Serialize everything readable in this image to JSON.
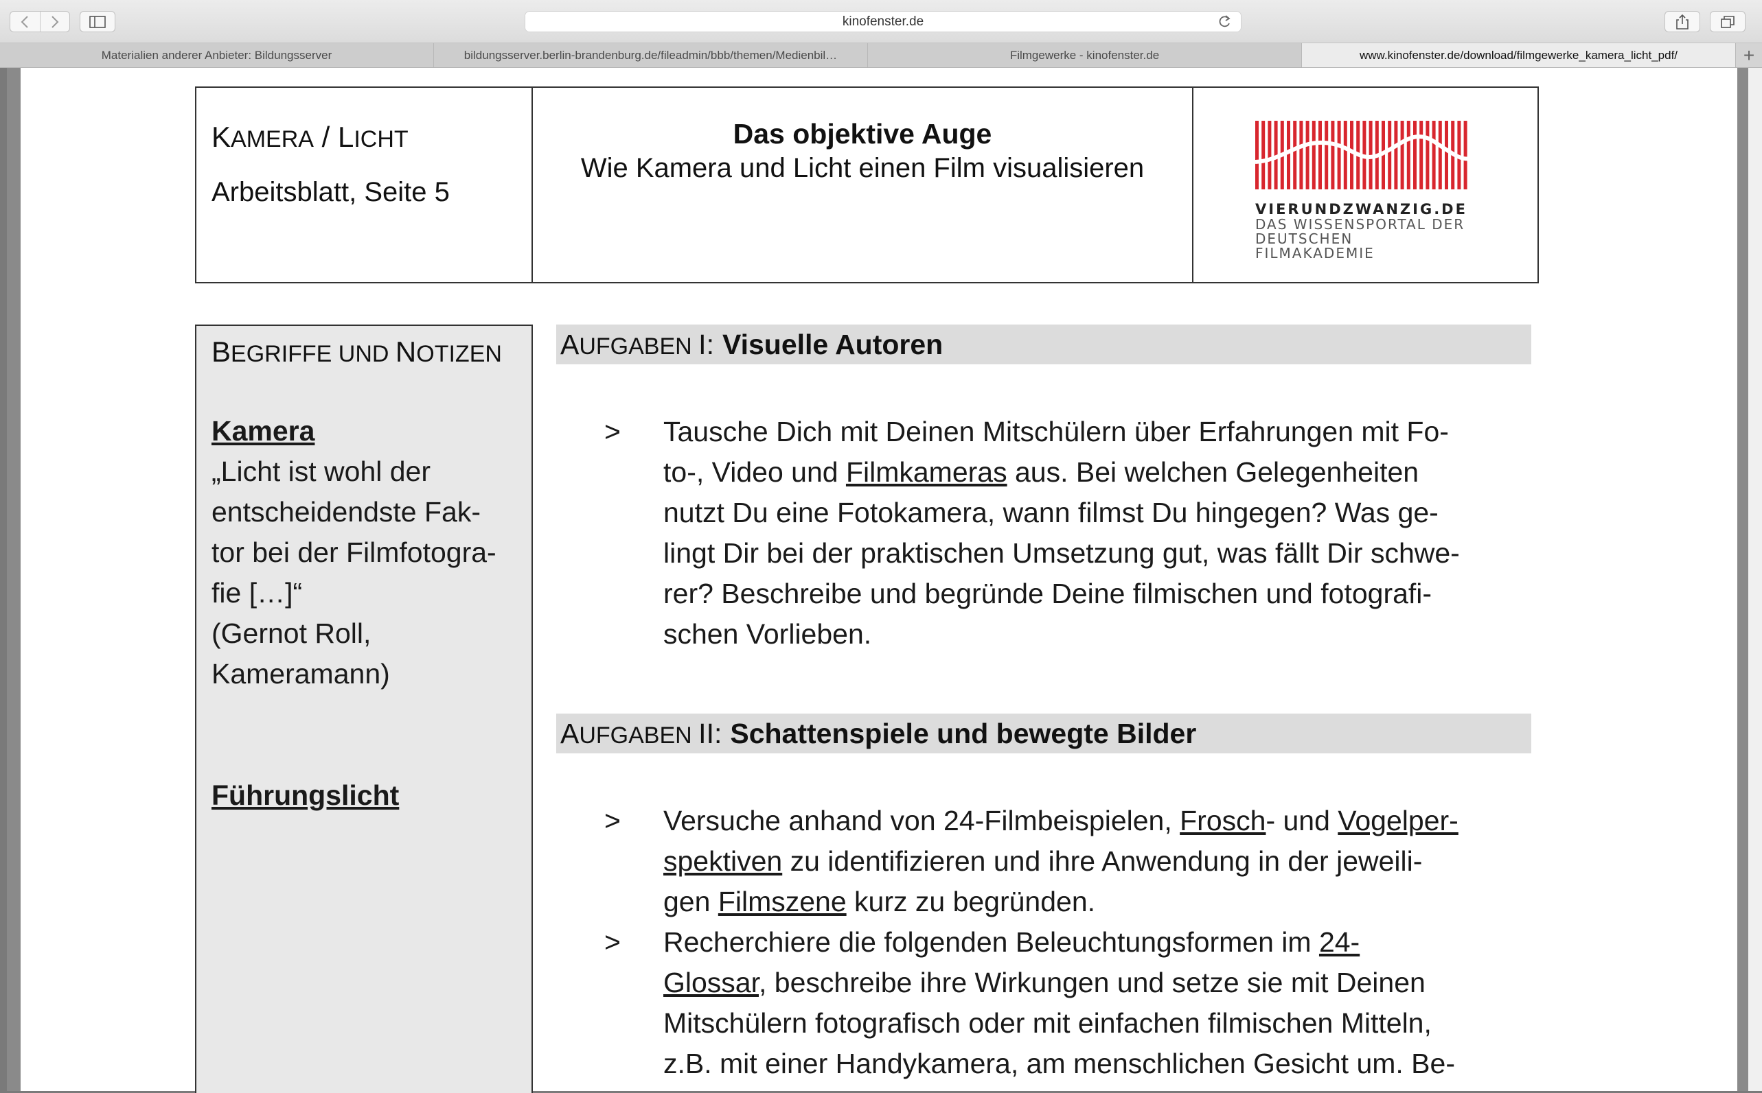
{
  "browser": {
    "address": "kinofenster.de",
    "tabs": [
      {
        "label": "Materialien anderer Anbieter: Bildungsserver",
        "active": false
      },
      {
        "label": "bildungsserver.berlin-brandenburg.de/fileadmin/bbb/themen/Medienbil…",
        "active": false
      },
      {
        "label": "Filmgewerke - kinofenster.de",
        "active": false
      },
      {
        "label": "www.kinofenster.de/download/filmgewerke_kamera_licht_pdf/",
        "active": true
      }
    ],
    "new_tab_symbol": "+"
  },
  "header": {
    "section_first_big": "K",
    "section_first_small": "AMERA",
    "section_sep": " / ",
    "section_second_big": "L",
    "section_second_small": "ICHT",
    "sheet_page": "Arbeitsblatt, Seite 5",
    "title": "Das objektive Auge",
    "subtitle": "Wie Kamera und Licht einen Film visualisieren",
    "logo_line1": "VIERUNDZWANZIG.DE",
    "logo_line2": "DAS WISSENSPORTAL DER",
    "logo_line3": "DEUTSCHEN FILMAKADEMIE",
    "logo_color": "#d8262e"
  },
  "notes": {
    "heading_b1": "B",
    "heading_s1": "EGRIFFE UND ",
    "heading_b2": "N",
    "heading_s2": "OTIZEN",
    "term1": "Kamera",
    "quote_lines": [
      "„Licht ist wohl der",
      "entscheidendste Fak-",
      "tor bei der Filmfotogra-",
      "fie […]“",
      "(Gernot Roll,",
      "Kameramann)"
    ],
    "term2": "Führungslicht"
  },
  "tasks": {
    "one": {
      "prefix_big": "A",
      "prefix_small": "UFGABEN ",
      "numeral": "I:",
      "title": "Visuelle Autoren"
    },
    "two": {
      "prefix_big": "A",
      "prefix_small": "UFGABEN ",
      "numeral": "II:",
      "title": "Schattenspiele und bewegte Bilder"
    },
    "arrow": ">",
    "b1": {
      "l1": "Tausche Dich mit Deinen Mitschülern über Erfahrungen mit Fo-",
      "l2a": "to-, Video und ",
      "l2link": "Filmkameras",
      "l2b": " aus. Bei welchen Gelegenheiten",
      "l3": "nutzt Du eine Fotokamera, wann filmst Du hingegen? Was ge-",
      "l4": "lingt Dir bei der praktischen Umsetzung gut, was fällt Dir schwe-",
      "l5": "rer? Beschreibe und begründe Deine filmischen und fotografi-",
      "l6": "schen Vorlieben."
    },
    "b2": {
      "l1a": "Versuche anhand von 24-Filmbeispielen, ",
      "l1link1": "Frosch",
      "l1b": "- und ",
      "l1link2": "Vogelper-",
      "l2link": "spektiven",
      "l2b": " zu identifizieren und ihre Anwendung in der jeweili-",
      "l3a": "gen ",
      "l3link": "Filmszene",
      "l3b": " kurz zu begründen."
    },
    "b3": {
      "l1a": "Recherchiere die folgenden Beleuchtungsformen im ",
      "l1link": "24-",
      "l2link": "Glossar",
      "l2b": ", beschreibe ihre Wirkungen und setze sie mit Deinen",
      "l3": "Mitschülern fotografisch oder mit einfachen filmischen Mitteln,",
      "l4": "z.B. mit einer Handykamera, am menschlichen Gesicht um. Be-"
    }
  }
}
